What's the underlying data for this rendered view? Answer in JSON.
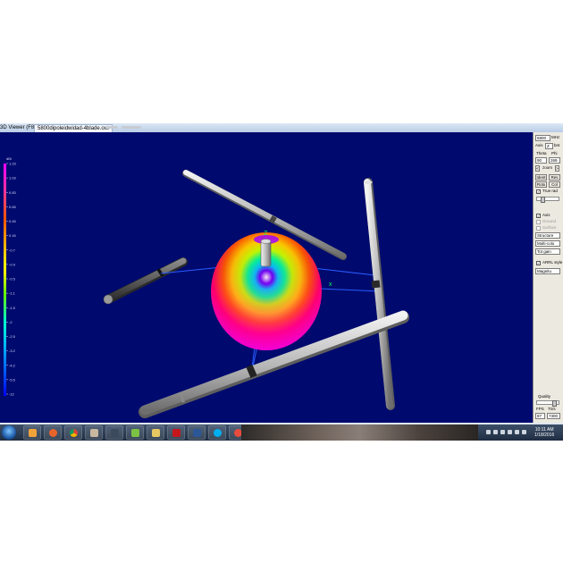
{
  "titlebar": {
    "title": "3D Viewer (F8)",
    "tab": "5800dipoleidwidad-4blade.out"
  },
  "legend": {
    "unit": "dBi",
    "ticks": [
      "1.23",
      "1.03",
      "0.83",
      "0.65",
      "0.45",
      "0.16",
      "-0.7",
      "-0.9",
      "-0.5",
      "-1.1",
      "-1.5",
      "-2",
      "-2.5",
      "-3.2",
      "-4.2",
      "-5.5",
      "-12"
    ]
  },
  "scene": {
    "axis_z_label": "Z",
    "axis_x_label": "x"
  },
  "panel": {
    "freq_value": "5800",
    "freq_unit": "MHz",
    "axis_label": "Axis",
    "axis_value": "Z",
    "axis_unit": "bnt",
    "theta_label": "Theta",
    "phi_label": "Phi",
    "theta_value": "90",
    "phi_value": "269",
    "zoom_left": "<",
    "zoom_label": "zoom",
    "zoom_right": ">",
    "ident_label": "Ident",
    "res_label": "Res",
    "rotx_label": "Rotx",
    "col_label": "Col",
    "true_rad_label": "True rad",
    "axis_cb_label": "Axis",
    "ground_label": "Ground",
    "surface_label": "Surface",
    "structure_select": "Structure",
    "multi_color_select": "Multi-colo",
    "tot_gain_select": "Tot gain",
    "arrl_style_label": "ARRL style",
    "magnitude_select": "Magnitu",
    "quality_label": "Quality",
    "fps_label": "FPS",
    "tris_label": "Tri/s",
    "fps_value": "87",
    "tris_value": "7300"
  },
  "tray": {
    "time": "10:11 AM",
    "date": "1/18/2016"
  },
  "colors": {
    "viewport_bg": "#000a6e",
    "legend_top": "#ff00ff",
    "legend_bottom": "#0000ff",
    "feed_lines": "#2a5cff",
    "element": "#b9b9b9"
  }
}
